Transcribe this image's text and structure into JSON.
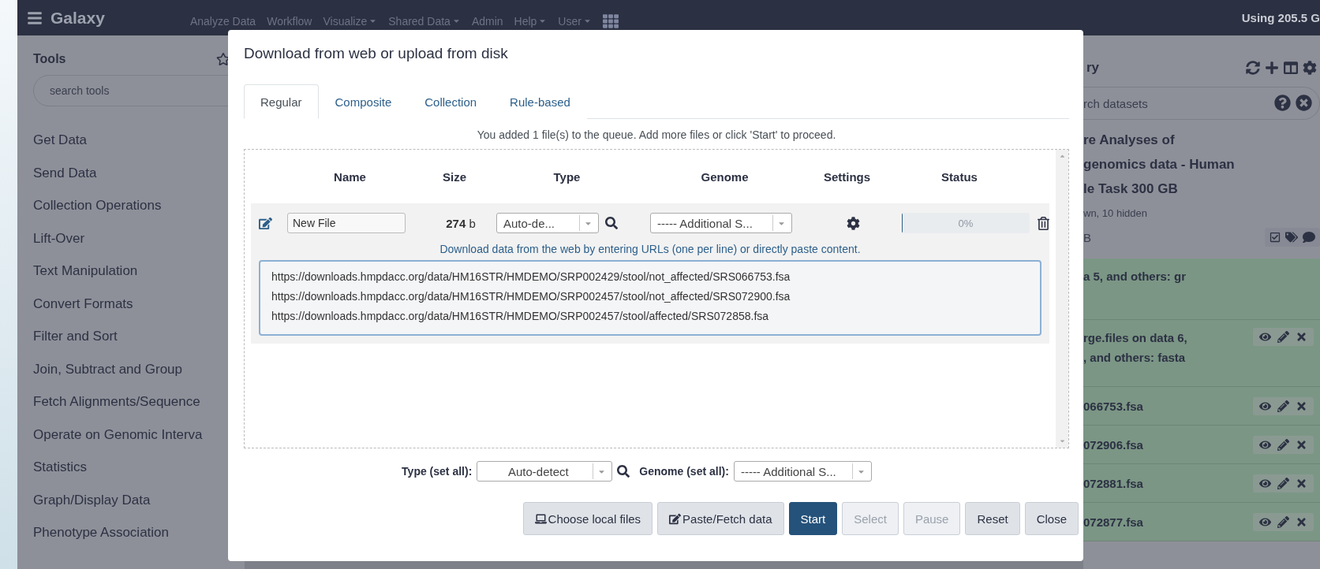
{
  "topbar": {
    "brand": "Galaxy",
    "nav": [
      {
        "label": "Analyze Data",
        "dropdown": false
      },
      {
        "label": "Workflow",
        "dropdown": false
      },
      {
        "label": "Visualize",
        "dropdown": true
      },
      {
        "label": "Shared Data",
        "dropdown": true
      },
      {
        "label": "Admin",
        "dropdown": false
      },
      {
        "label": "Help",
        "dropdown": true
      },
      {
        "label": "User",
        "dropdown": true
      }
    ],
    "quota": "Using 205.5 G"
  },
  "tools": {
    "title": "Tools",
    "search": {
      "placeholder": "search tools"
    },
    "items": [
      "Get Data",
      "Send Data",
      "Collection Operations",
      "Lift-Over",
      "Text Manipulation",
      "Convert Formats",
      "Filter and Sort",
      "Join, Subtract and Group",
      "Fetch Alignments/Sequence",
      "Operate on Genomic Interva",
      "Statistics",
      "Graph/Display Data",
      "Phenotype Association"
    ]
  },
  "history": {
    "title": "ry",
    "search": {
      "placeholder": "rch datasets"
    },
    "name_lines": [
      "re Analyses of",
      "genomics data - Human",
      "le Task 300 GB"
    ],
    "summary": "wn, 10 hidden",
    "size": "B",
    "datasets": [
      {
        "lines": [
          "a 5, and others: gr"
        ],
        "actions": false
      },
      {
        "lines": [
          "rge.files on data 6,",
          ", and others: fasta"
        ],
        "actions": true
      },
      {
        "lines": [
          "066753.fsa"
        ],
        "actions": true
      },
      {
        "lines": [
          "072906.fsa"
        ],
        "actions": true
      },
      {
        "lines": [
          "072881.fsa"
        ],
        "actions": true
      },
      {
        "lines": [
          "072877.fsa"
        ],
        "actions": true
      }
    ]
  },
  "dialog": {
    "title": "Download from web or upload from disk",
    "tabs": [
      {
        "label": "Regular",
        "selected": true
      },
      {
        "label": "Composite",
        "selected": false
      },
      {
        "label": "Collection",
        "selected": false
      },
      {
        "label": "Rule-based",
        "selected": false
      }
    ],
    "message": "You added 1 file(s) to the queue. Add more files or click 'Start' to proceed.",
    "columns": [
      "Name",
      "Size",
      "Type",
      "Genome",
      "Settings",
      "Status"
    ],
    "file": {
      "name": "New File",
      "size": "274",
      "unit": "b",
      "type": "Auto-de...",
      "genome": "----- Additional S...",
      "progress": "0%",
      "level": 0,
      "hint": "Download data from the web by entering URLs (one per line) or directly paste content.",
      "urls": [
        "https://downloads.hmpdacc.org/data/HM16STR/HMDEMO/SRP002429/stool/not_affected/SRS066753.fsa",
        "https://downloads.hmpdacc.org/data/HM16STR/HMDEMO/SRP002457/stool/not_affected/SRS072900.fsa",
        "https://downloads.hmpdacc.org/data/HM16STR/HMDEMO/SRP002457/stool/affected/SRS072858.fsa"
      ]
    },
    "type_all": {
      "label": "Type (set all):",
      "value": "Auto-detect"
    },
    "genome_all": {
      "label": "Genome (set all):",
      "value": "----- Additional S..."
    },
    "buttons": [
      {
        "label": "Choose local files",
        "kind": "local",
        "disabled": false
      },
      {
        "label": "Paste/Fetch data",
        "kind": "paste",
        "disabled": false
      },
      {
        "label": "Start",
        "kind": "primary",
        "disabled": false
      },
      {
        "label": "Select",
        "kind": "plain",
        "disabled": true
      },
      {
        "label": "Pause",
        "kind": "plain",
        "disabled": true
      },
      {
        "label": "Reset",
        "kind": "plain",
        "disabled": false
      },
      {
        "label": "Close",
        "kind": "plain",
        "disabled": false
      }
    ]
  }
}
